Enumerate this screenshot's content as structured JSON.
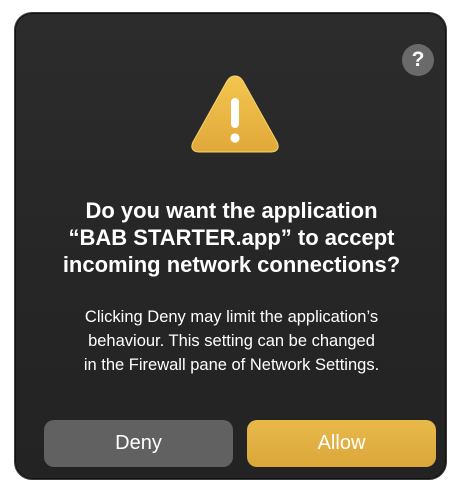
{
  "dialog": {
    "help_label": "?",
    "icon": "warning-triangle-icon",
    "title_lines": [
      "Do you want the application",
      "“BAB STARTER.app” to accept",
      "incoming network connections?"
    ],
    "message_lines": [
      "Clicking Deny may limit the application’s",
      "behaviour. This setting can be changed",
      "in the Firewall pane of Network Settings."
    ],
    "buttons": {
      "deny": "Deny",
      "allow": "Allow"
    }
  },
  "colors": {
    "background": "#262626",
    "accent": "#e3b040",
    "secondary_button": "#616161",
    "text": "#ffffff"
  }
}
